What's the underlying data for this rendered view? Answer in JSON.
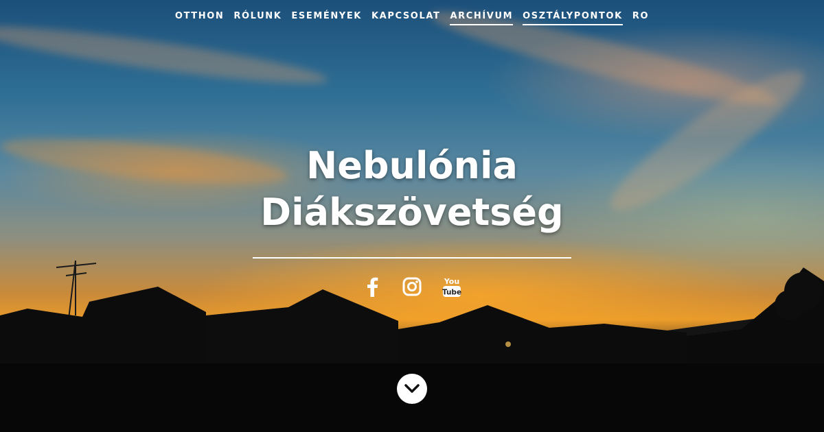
{
  "nav": {
    "items": [
      {
        "label": "OTTHON"
      },
      {
        "label": "RÓLUNK"
      },
      {
        "label": "ESEMÉNYEK"
      },
      {
        "label": "KAPCSOLAT"
      },
      {
        "label": "ARCHÍVUM"
      },
      {
        "label": "OSZTÁLYPONTOK"
      },
      {
        "label": "RO"
      }
    ]
  },
  "hero": {
    "title_line1": "Nebulónia",
    "title_line2": "Diákszövetség",
    "youtube_you": "You",
    "youtube_tube": "Tube"
  },
  "icons": [
    "facebook-icon",
    "instagram-icon",
    "youtube-icon",
    "chevron-down-icon"
  ]
}
